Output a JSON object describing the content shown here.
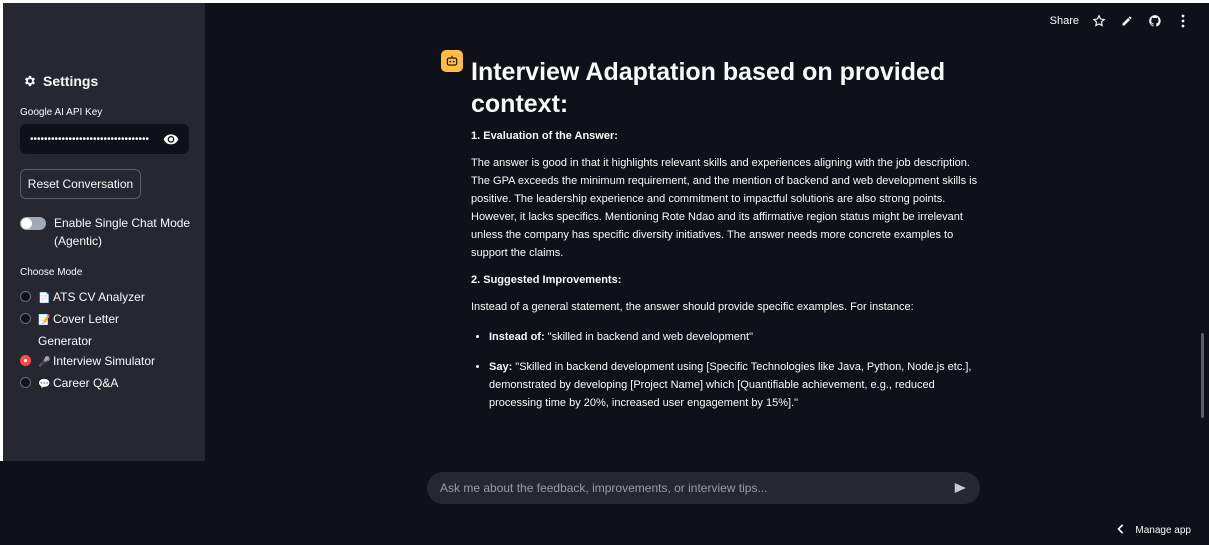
{
  "sidebar": {
    "title": "Settings",
    "api_key_label": "Google AI API Key",
    "api_key_value": "••••••••••••••••••••••••••••••••••",
    "reset_button": "Reset Conversation",
    "toggle_label": "Enable Single Chat Mode (Agentic)",
    "toggle_on": false,
    "mode_label": "Choose Mode",
    "modes": [
      {
        "label": "ATS CV Analyzer",
        "icon": "page-icon",
        "selected": false
      },
      {
        "label": "Cover Letter Generator",
        "icon": "memo-icon",
        "selected": false
      },
      {
        "label": "Interview Simulator",
        "icon": "microphone-icon",
        "selected": true
      },
      {
        "label": "Career Q&A",
        "icon": "speech-bubble-icon",
        "selected": false
      }
    ]
  },
  "toolbar": {
    "share": "Share"
  },
  "message": {
    "heading": "Interview Adaptation based on provided context:",
    "section1": "1. Evaluation of the Answer:",
    "para1": "The answer is good in that it highlights relevant skills and experiences aligning with the job description. The GPA exceeds the minimum requirement, and the mention of backend and web development skills is positive. The leadership experience and commitment to impactful solutions are also strong points. However, it lacks specifics. Mentioning Rote Ndao and its affirmative region status might be irrelevant unless the company has specific diversity initiatives. The answer needs more concrete examples to support the claims.",
    "section2": "2. Suggested Improvements:",
    "para2": "Instead of a general statement, the answer should provide specific examples. For instance:",
    "bullets": [
      {
        "label": "Instead of:",
        "text": " \"skilled in backend and web development\""
      },
      {
        "label": "Say:",
        "text": " \"Skilled in backend development using [Specific Technologies like Java, Python, Node.js etc.], demonstrated by developing [Project Name] which [Quantifiable achievement, e.g., reduced processing time by 20%, increased user engagement by 15%].\""
      }
    ]
  },
  "chat": {
    "placeholder": "Ask me about the feedback, improvements, or interview tips..."
  },
  "footer": {
    "manage_app": "Manage app"
  },
  "colors": {
    "background": "#0e1117",
    "sidebar": "#262730",
    "accent": "#ff4b4b",
    "avatar": "#ffbd45"
  }
}
